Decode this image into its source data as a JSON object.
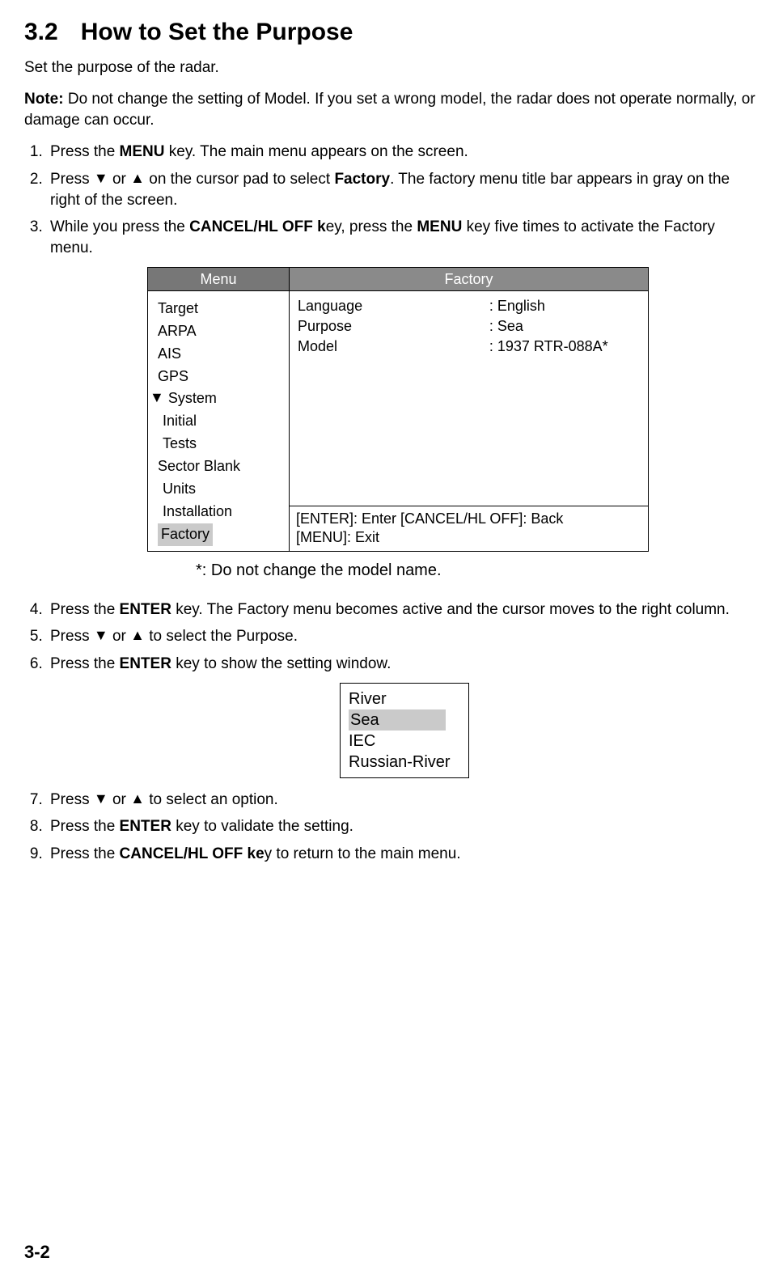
{
  "heading": {
    "number": "3.2",
    "title": "How to Set the Purpose"
  },
  "intro": "Set the purpose of the radar.",
  "note": {
    "label": "Note:",
    "text": " Do not change the setting of Model. If you set a wrong model, the radar does not operate normally, or damage can occur."
  },
  "step1": {
    "pre": "Press the ",
    "key": "MENU",
    "post": " key. The main menu appears on the screen."
  },
  "step2": {
    "t1": "Press ",
    "down": "▼",
    "t2": " or ",
    "up": "▲",
    "t3": " on the cursor pad to select ",
    "bold": "Factory",
    "t4": ". The factory menu title bar appears in gray on the right of the screen."
  },
  "step3": {
    "t1": "While you press the ",
    "b1": "CANCEL/HL OFF k",
    "t2": "ey, press the ",
    "b2": "MENU",
    "t3": " key five times to activate the Factory menu."
  },
  "menu": {
    "leftHeader": "Menu",
    "rightHeader": "Factory",
    "leftItems": {
      "i0": "Target",
      "i1": "ARPA",
      "i2": "AIS",
      "i3": "GPS",
      "systemArrow": "▼",
      "systemLabel": "System",
      "s0": "Initial",
      "s1": "Tests",
      "s2": "Sector Blank",
      "s3": "Units",
      "s4": "Installation",
      "factory": "Factory"
    },
    "rightKeys": {
      "k0": "Language",
      "k1": "Purpose",
      "k2": "Model"
    },
    "rightVals": {
      "v0": ": English",
      "v1": ": Sea",
      "v2": ": 1937 RTR-088A*"
    },
    "footer1": "[ENTER]: Enter   [CANCEL/HL OFF]: Back",
    "footer2": "[MENU]: Exit"
  },
  "footnote": "*: Do not change the model name.",
  "step4": {
    "t1": "Press the ",
    "b1": "ENTER",
    "t2": " key. The Factory menu becomes active and the cursor moves to the right column."
  },
  "step5": {
    "t1": "Press ",
    "down": "▼",
    "t2": " or ",
    "up": "▲",
    "t3": " to select the Purpose."
  },
  "step6": {
    "t1": "Press the ",
    "b1": "ENTER",
    "t2": " key to show the setting window."
  },
  "popup": {
    "opt0": "River",
    "opt1": "Sea",
    "opt2": "IEC",
    "opt3": "Russian-River"
  },
  "step7": {
    "t1": "Press ",
    "down": "▼",
    "t2": " or ",
    "up": "▲",
    "t3": " to select an option."
  },
  "step8": {
    "t1": "Press the ",
    "b1": "ENTER",
    "t2": " key to validate the setting."
  },
  "step9": {
    "t1": "Press the ",
    "b1": "CANCEL/HL OFF ke",
    "t2": "y to return to the main menu."
  },
  "pageNumber": "3-2"
}
